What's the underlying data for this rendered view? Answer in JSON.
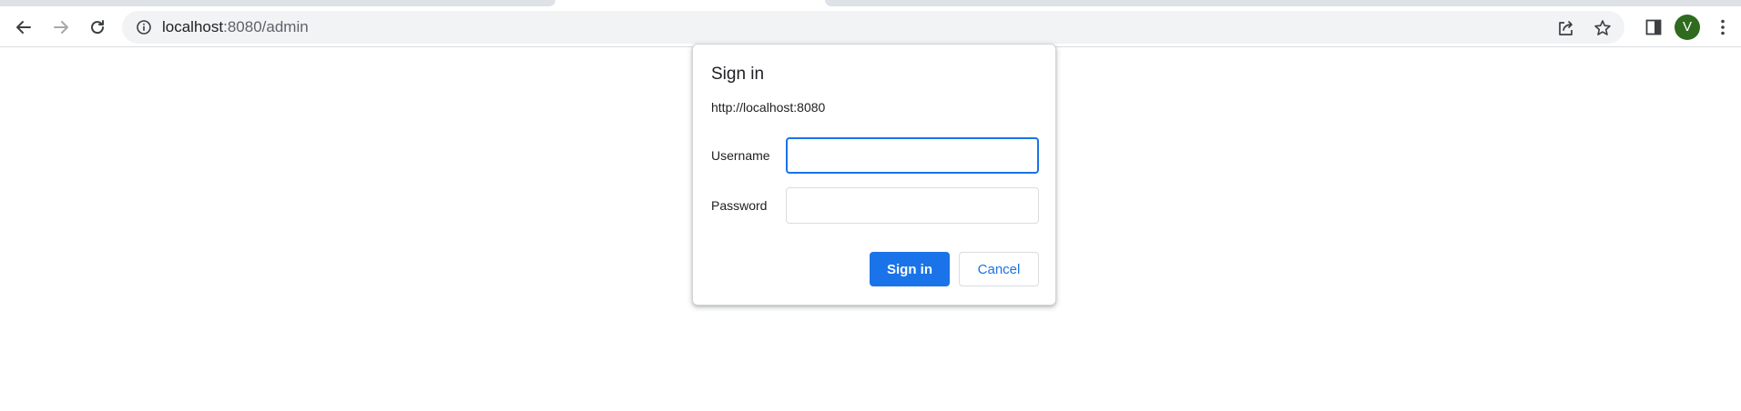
{
  "browser": {
    "address_bar": {
      "host": "localhost",
      "port_path": ":8080/admin"
    },
    "profile": {
      "initial": "V",
      "color": "#2e6b1f"
    },
    "icons": {
      "back": "arrow-left-icon",
      "forward": "arrow-right-icon",
      "reload": "reload-icon",
      "site_info": "info-circle-icon",
      "share": "share-icon",
      "bookmark": "star-icon",
      "side_panel": "side-panel-icon",
      "menu": "kebab-menu-icon"
    }
  },
  "dialog": {
    "title": "Sign in",
    "origin": "http://localhost:8080",
    "username_label": "Username",
    "username_value": "",
    "password_label": "Password",
    "password_value": "",
    "signin_label": "Sign in",
    "cancel_label": "Cancel",
    "accent_color": "#1a73e8"
  }
}
